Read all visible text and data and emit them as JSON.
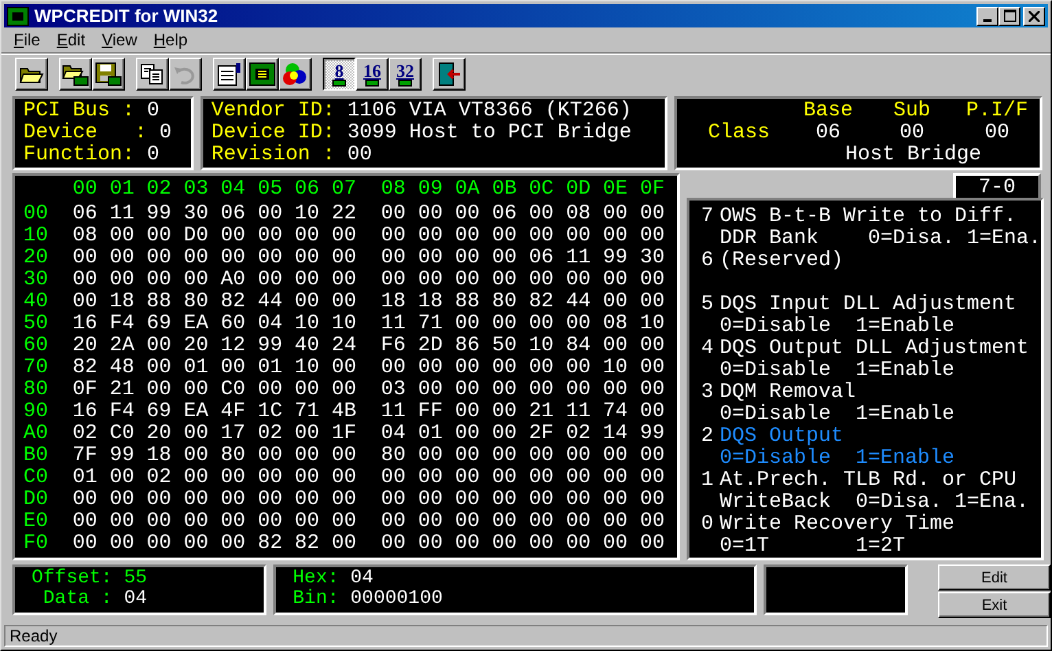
{
  "window": {
    "title": "WPCREDIT for WIN32"
  },
  "menu": [
    "File",
    "Edit",
    "View",
    "Help"
  ],
  "toolbar": [
    {
      "kind": "open",
      "pressed": false,
      "disabled": false
    },
    {
      "kind": "gap"
    },
    {
      "kind": "load",
      "pressed": false,
      "disabled": false
    },
    {
      "kind": "save",
      "pressed": false,
      "disabled": false
    },
    {
      "kind": "gap"
    },
    {
      "kind": "copy",
      "pressed": false,
      "disabled": false
    },
    {
      "kind": "undo",
      "pressed": false,
      "disabled": true
    },
    {
      "kind": "gap"
    },
    {
      "kind": "props",
      "pressed": false,
      "disabled": false
    },
    {
      "kind": "board",
      "pressed": false,
      "disabled": false
    },
    {
      "kind": "colors",
      "pressed": false,
      "disabled": false
    },
    {
      "kind": "gap"
    },
    {
      "kind": "width",
      "label": "8",
      "pressed": true,
      "disabled": false
    },
    {
      "kind": "width",
      "label": "16",
      "pressed": false,
      "disabled": false
    },
    {
      "kind": "width",
      "label": "32",
      "pressed": false,
      "disabled": false
    },
    {
      "kind": "gap"
    },
    {
      "kind": "exit",
      "pressed": false,
      "disabled": false
    }
  ],
  "location": [
    {
      "label": "PCI Bus : ",
      "value": "0"
    },
    {
      "label": "Device   : ",
      "value": "0"
    },
    {
      "label": "Function: ",
      "value": "0"
    }
  ],
  "ids": [
    {
      "label": "Vendor ID: ",
      "value": "1106 VIA VT8366 (KT266)"
    },
    {
      "label": "Device ID: ",
      "value": "3099 Host to PCI Bridge"
    },
    {
      "label": "Revision : ",
      "value": "00"
    }
  ],
  "class": {
    "label": "Class",
    "headers": [
      "Base",
      "Sub",
      "P.I/F"
    ],
    "values": [
      "06",
      "00",
      "00"
    ],
    "name": "Host Bridge"
  },
  "hex": {
    "columns": [
      "00",
      "01",
      "02",
      "03",
      "04",
      "05",
      "06",
      "07",
      "08",
      "09",
      "0A",
      "0B",
      "0C",
      "0D",
      "0E",
      "0F"
    ],
    "rows": [
      {
        "label": "00",
        "values": [
          "06",
          "11",
          "99",
          "30",
          "06",
          "00",
          "10",
          "22",
          "00",
          "00",
          "00",
          "06",
          "00",
          "08",
          "00",
          "00"
        ]
      },
      {
        "label": "10",
        "values": [
          "08",
          "00",
          "00",
          "D0",
          "00",
          "00",
          "00",
          "00",
          "00",
          "00",
          "00",
          "00",
          "00",
          "00",
          "00",
          "00"
        ]
      },
      {
        "label": "20",
        "values": [
          "00",
          "00",
          "00",
          "00",
          "00",
          "00",
          "00",
          "00",
          "00",
          "00",
          "00",
          "00",
          "06",
          "11",
          "99",
          "30"
        ]
      },
      {
        "label": "30",
        "values": [
          "00",
          "00",
          "00",
          "00",
          "A0",
          "00",
          "00",
          "00",
          "00",
          "00",
          "00",
          "00",
          "00",
          "00",
          "00",
          "00"
        ]
      },
      {
        "label": "40",
        "values": [
          "00",
          "18",
          "88",
          "80",
          "82",
          "44",
          "00",
          "00",
          "18",
          "18",
          "88",
          "80",
          "82",
          "44",
          "00",
          "00"
        ]
      },
      {
        "label": "50",
        "values": [
          "16",
          "F4",
          "69",
          "EA",
          "60",
          "04",
          "10",
          "10",
          "11",
          "71",
          "00",
          "00",
          "00",
          "00",
          "08",
          "10"
        ]
      },
      {
        "label": "60",
        "values": [
          "20",
          "2A",
          "00",
          "20",
          "12",
          "99",
          "40",
          "24",
          "F6",
          "2D",
          "86",
          "50",
          "10",
          "84",
          "00",
          "00"
        ]
      },
      {
        "label": "70",
        "values": [
          "82",
          "48",
          "00",
          "01",
          "00",
          "01",
          "10",
          "00",
          "00",
          "00",
          "00",
          "00",
          "00",
          "00",
          "10",
          "00"
        ]
      },
      {
        "label": "80",
        "values": [
          "0F",
          "21",
          "00",
          "00",
          "C0",
          "00",
          "00",
          "00",
          "03",
          "00",
          "00",
          "00",
          "00",
          "00",
          "00",
          "00"
        ]
      },
      {
        "label": "90",
        "values": [
          "16",
          "F4",
          "69",
          "EA",
          "4F",
          "1C",
          "71",
          "4B",
          "11",
          "FF",
          "00",
          "00",
          "21",
          "11",
          "74",
          "00"
        ]
      },
      {
        "label": "A0",
        "values": [
          "02",
          "C0",
          "20",
          "00",
          "17",
          "02",
          "00",
          "1F",
          "04",
          "01",
          "00",
          "00",
          "2F",
          "02",
          "14",
          "99"
        ]
      },
      {
        "label": "B0",
        "values": [
          "7F",
          "99",
          "18",
          "00",
          "80",
          "00",
          "00",
          "00",
          "80",
          "00",
          "00",
          "00",
          "00",
          "00",
          "00",
          "00"
        ]
      },
      {
        "label": "C0",
        "values": [
          "01",
          "00",
          "02",
          "00",
          "00",
          "00",
          "00",
          "00",
          "00",
          "00",
          "00",
          "00",
          "00",
          "00",
          "00",
          "00"
        ]
      },
      {
        "label": "D0",
        "values": [
          "00",
          "00",
          "00",
          "00",
          "00",
          "00",
          "00",
          "00",
          "00",
          "00",
          "00",
          "00",
          "00",
          "00",
          "00",
          "00"
        ]
      },
      {
        "label": "E0",
        "values": [
          "00",
          "00",
          "00",
          "00",
          "00",
          "00",
          "00",
          "00",
          "00",
          "00",
          "00",
          "00",
          "00",
          "00",
          "00",
          "00"
        ]
      },
      {
        "label": "F0",
        "values": [
          "00",
          "00",
          "00",
          "00",
          "00",
          "82",
          "82",
          "00",
          "00",
          "00",
          "00",
          "00",
          "00",
          "00",
          "00",
          "00"
        ]
      }
    ]
  },
  "bits": {
    "tab": "7-0",
    "items": [
      {
        "bit": "7",
        "lines": [
          "OWS B-t-B Write to Diff.",
          "DDR Bank    0=Disa. 1=Ena."
        ],
        "selected": false
      },
      {
        "bit": "6",
        "lines": [
          "(Reserved)"
        ],
        "selected": false
      },
      {
        "bit": "5",
        "lines": [
          "DQS Input DLL Adjustment",
          "0=Disable  1=Enable"
        ],
        "selected": false
      },
      {
        "bit": "4",
        "lines": [
          "DQS Output DLL Adjustment",
          "0=Disable  1=Enable"
        ],
        "selected": false
      },
      {
        "bit": "3",
        "lines": [
          "DQM Removal",
          "0=Disable  1=Enable"
        ],
        "selected": false
      },
      {
        "bit": "2",
        "lines": [
          "DQS Output",
          "0=Disable  1=Enable"
        ],
        "selected": true
      },
      {
        "bit": "1",
        "lines": [
          "At.Prech. TLB Rd. or CPU",
          "WriteBack  0=Disa. 1=Ena."
        ],
        "selected": false
      },
      {
        "bit": "0",
        "lines": [
          "Write Recovery Time",
          "0=1T       1=2T"
        ],
        "selected": false
      }
    ]
  },
  "offset": {
    "label": "Offset: ",
    "value": "55"
  },
  "data": {
    "label": " Data : ",
    "value": "04"
  },
  "hex_value": {
    "label": "Hex: ",
    "value": "04"
  },
  "bin_value": {
    "label": "Bin: ",
    "value": "00000100"
  },
  "buttons": [
    "Edit",
    "Exit"
  ],
  "status_bar": "Ready"
}
